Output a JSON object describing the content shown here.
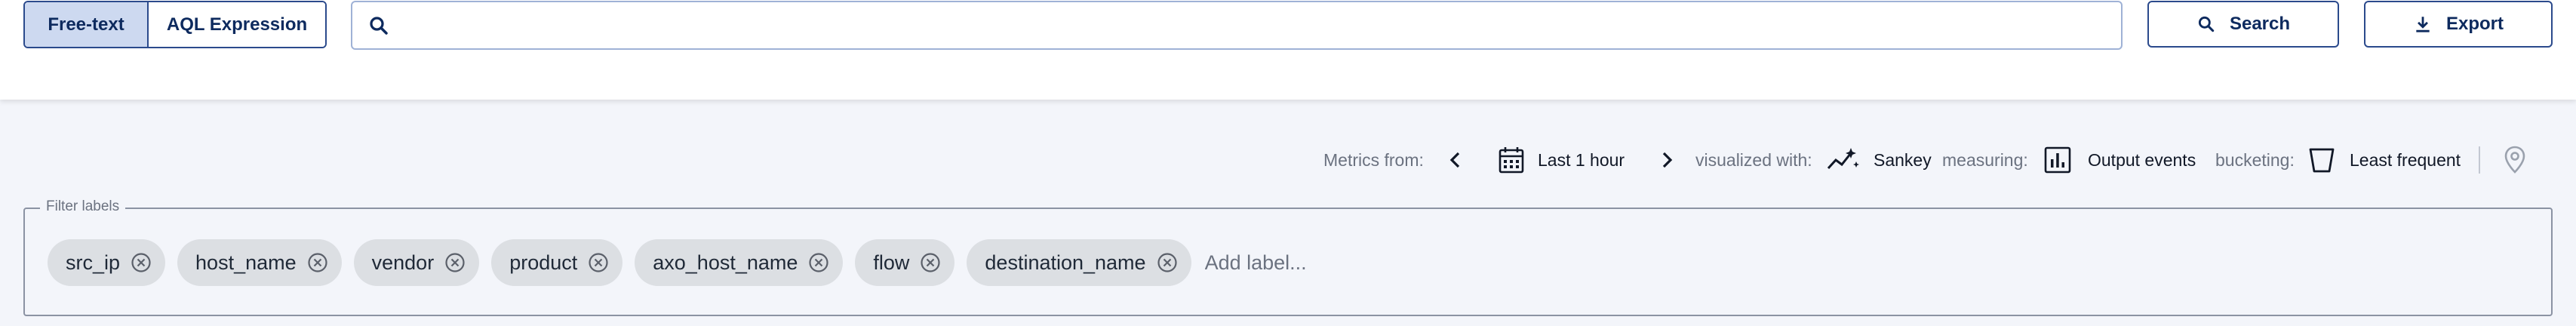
{
  "query_mode": {
    "options": [
      "Free-text",
      "AQL Expression"
    ],
    "selected": "Free-text"
  },
  "search": {
    "value": "",
    "placeholder": "",
    "icon": "search-icon"
  },
  "actions": {
    "search_label": "Search",
    "export_label": "Export"
  },
  "metrics": {
    "from_label": "Metrics from:",
    "time_range": "Last 1 hour",
    "visualized_label": "visualized with:",
    "visualization": "Sankey",
    "measuring_label": "measuring:",
    "measure": "Output events",
    "bucketing_label": "bucketing:",
    "bucketing": "Least frequent"
  },
  "filter_labels": {
    "legend": "Filter labels",
    "chips": [
      "src_ip",
      "host_name",
      "vendor",
      "product",
      "axo_host_name",
      "flow",
      "destination_name"
    ],
    "add_placeholder": "Add label..."
  },
  "colors": {
    "accent": "#2b4a8c",
    "selected_toggle_bg": "#cdd9f0",
    "chip_bg": "#dcdfe3",
    "page_bg": "#f3f5fa"
  }
}
